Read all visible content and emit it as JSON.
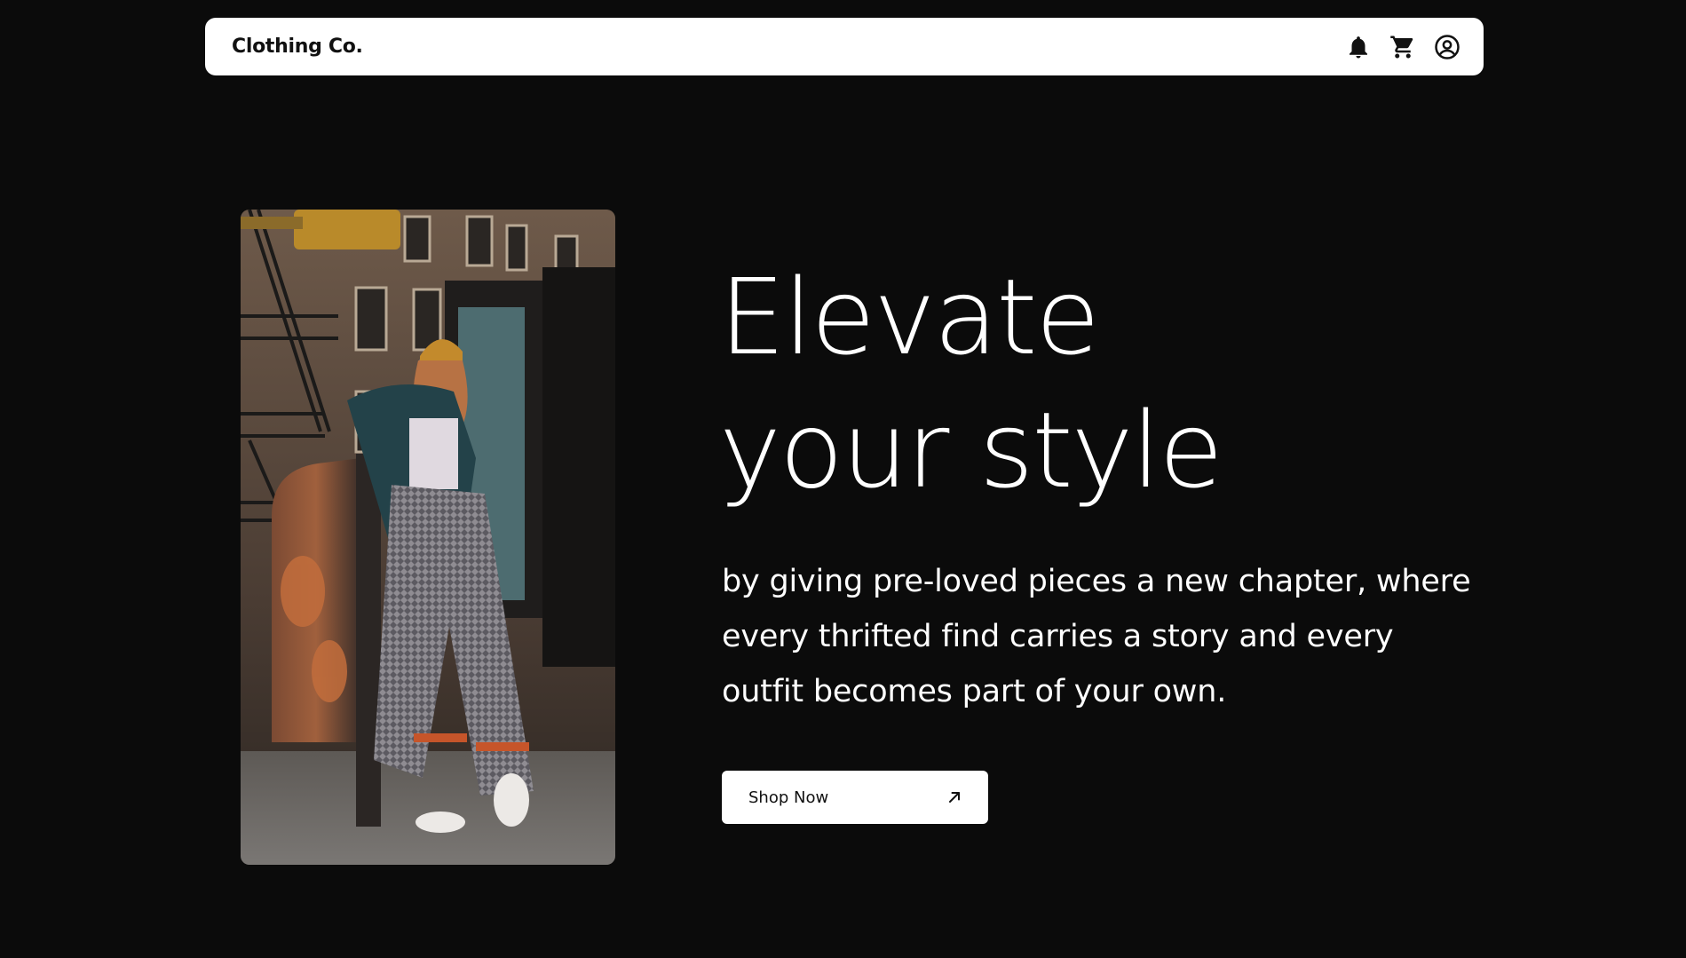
{
  "navbar": {
    "brand": "Clothing Co.",
    "icons": [
      "bell-icon",
      "cart-icon",
      "account-icon"
    ]
  },
  "hero": {
    "title_line1": "Elevate",
    "title_line2": "your style",
    "subtitle_line1": "by giving pre-loved pieces a new chapter, where",
    "subtitle_line2": "every thrifted find carries a story and every",
    "subtitle_line3": "outfit becomes part of your own.",
    "cta_label": "Shop Now",
    "cta_icon": "arrow-up-right-icon"
  },
  "colors": {
    "background": "#0b0b0b",
    "surface": "#ffffff",
    "text_dark": "#111111",
    "text_light": "#ffffff"
  }
}
